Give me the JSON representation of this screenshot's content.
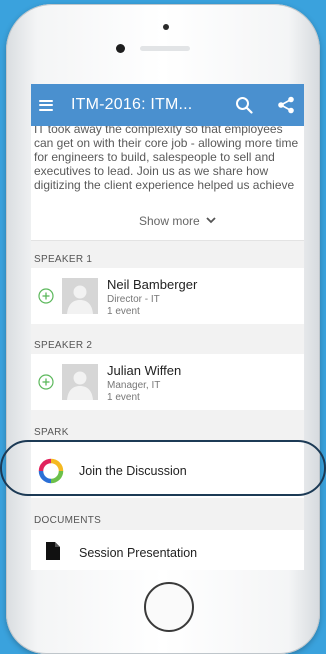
{
  "appbar": {
    "title": "ITM-2016: ITM...",
    "menu_icon": "hamburger-menu-icon",
    "search_icon": "search-icon",
    "share_icon": "share-icon"
  },
  "description": {
    "text": "IT took away the complexity so that employees can get on with their core job - allowing more time for engineers to build, salespeople to sell and executives to lead. Join us as we share how digitizing the client experience helped us achieve"
  },
  "show_more": {
    "label": "Show more"
  },
  "speakers": [
    {
      "section": "SPEAKER 1",
      "name": "Neil Bamberger",
      "role": "Director - IT",
      "events": "1 event"
    },
    {
      "section": "SPEAKER 2",
      "name": "Julian Wiffen",
      "role": "Manager, IT",
      "events": "1 event"
    }
  ],
  "spark": {
    "section": "SPARK",
    "label": "Join the Discussion"
  },
  "documents": {
    "section": "DOCUMENTS",
    "label": "Session Presentation"
  },
  "colors": {
    "appbar": "#4a90cf",
    "background": "#3aa2dd",
    "accent_green": "#5cb85c",
    "highlight_ring": "#1c3a55"
  }
}
